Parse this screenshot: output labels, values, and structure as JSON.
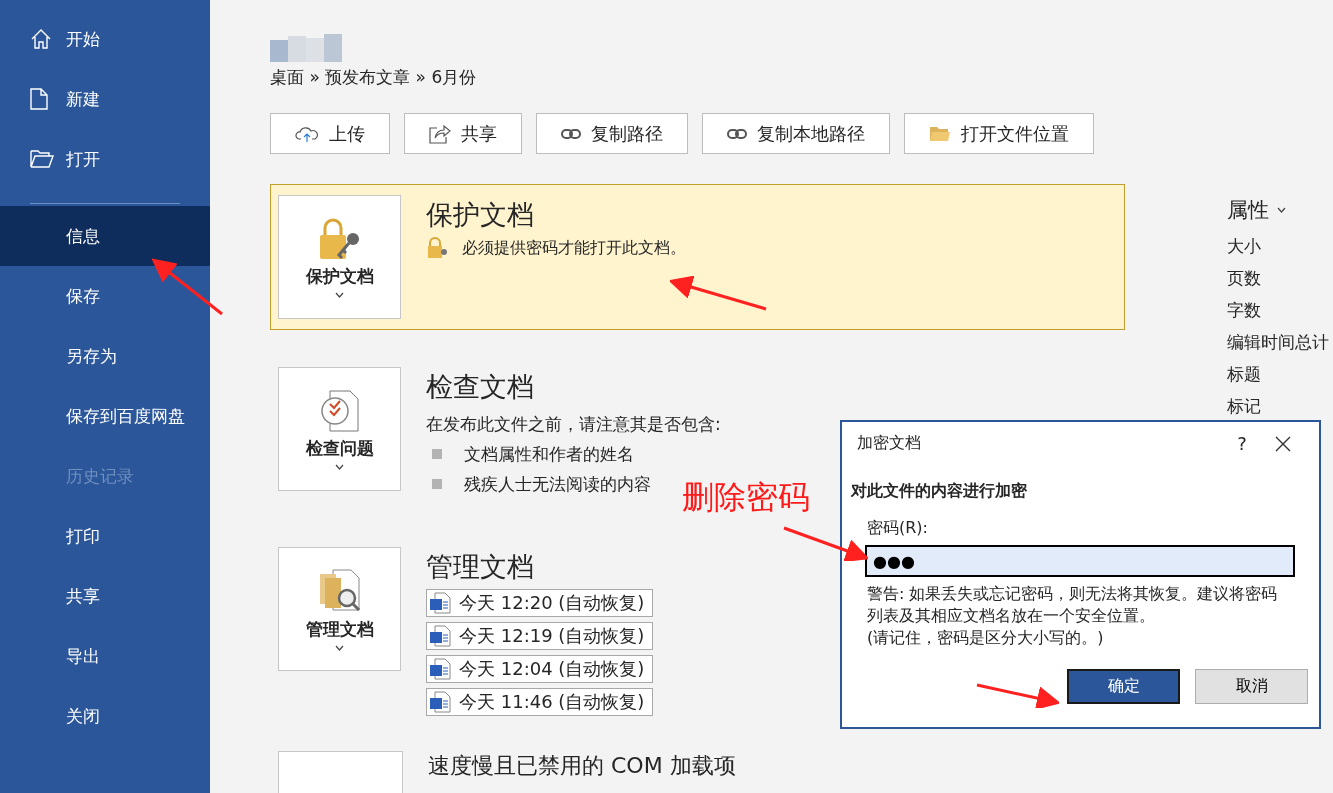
{
  "sidebar": {
    "items": [
      {
        "label": "开始",
        "selected": false,
        "disabled": false
      },
      {
        "label": "新建",
        "selected": false,
        "disabled": false
      },
      {
        "label": "打开",
        "selected": false,
        "disabled": false
      },
      {
        "label": "信息",
        "selected": true,
        "disabled": false
      },
      {
        "label": "保存",
        "selected": false,
        "disabled": false
      },
      {
        "label": "另存为",
        "selected": false,
        "disabled": false
      },
      {
        "label": "保存到百度网盘",
        "selected": false,
        "disabled": false
      },
      {
        "label": "历史记录",
        "selected": false,
        "disabled": true
      },
      {
        "label": "打印",
        "selected": false,
        "disabled": false
      },
      {
        "label": "共享",
        "selected": false,
        "disabled": false
      },
      {
        "label": "导出",
        "selected": false,
        "disabled": false
      },
      {
        "label": "关闭",
        "selected": false,
        "disabled": false
      }
    ]
  },
  "breadcrumb": "桌面 » 预发布文章 » 6月份",
  "toolbar": [
    {
      "label": "上传"
    },
    {
      "label": "共享"
    },
    {
      "label": "复制路径"
    },
    {
      "label": "复制本地路径"
    },
    {
      "label": "打开文件位置"
    }
  ],
  "sections": [
    {
      "kind": "protect",
      "button": "保护文档",
      "title": "保护文档",
      "highlighted": true,
      "notice": "必须提供密码才能打开此文档。"
    },
    {
      "kind": "inspect",
      "button": "检查问题",
      "title": "检查文档",
      "highlighted": false,
      "description": "在发布此文件之前，请注意其是否包含:",
      "bullets": [
        "文档属性和作者的姓名",
        "残疾人士无法阅读的内容"
      ]
    },
    {
      "kind": "manage",
      "button": "管理文档",
      "title": "管理文档",
      "highlighted": false,
      "versions": [
        "今天 12:20 (自动恢复)",
        "今天 12:19 (自动恢复)",
        "今天 12:04 (自动恢复)",
        "今天 11:46 (自动恢复)"
      ]
    },
    {
      "kind": "performance",
      "title": "速度慢且已禁用的 COM 加载项",
      "highlighted": false
    }
  ],
  "properties": {
    "heading": "属性",
    "items": [
      "大小",
      "页数",
      "字数",
      "编辑时间总计",
      "标题",
      "标记"
    ]
  },
  "dialog": {
    "title": "加密文档",
    "help": "?",
    "heading": "对此文件的内容进行加密",
    "field_label": "密码(R):",
    "password": "●●●",
    "warning": "警告: 如果丢失或忘记密码，则无法将其恢复。建议将密码列表及其相应文档名放在一个安全位置。",
    "note": "(请记住，密码是区分大小写的。)",
    "buttons": [
      {
        "label": "确定",
        "selected": true
      },
      {
        "label": "取消",
        "selected": false
      }
    ]
  },
  "annotation": {
    "label": "删除密码"
  }
}
